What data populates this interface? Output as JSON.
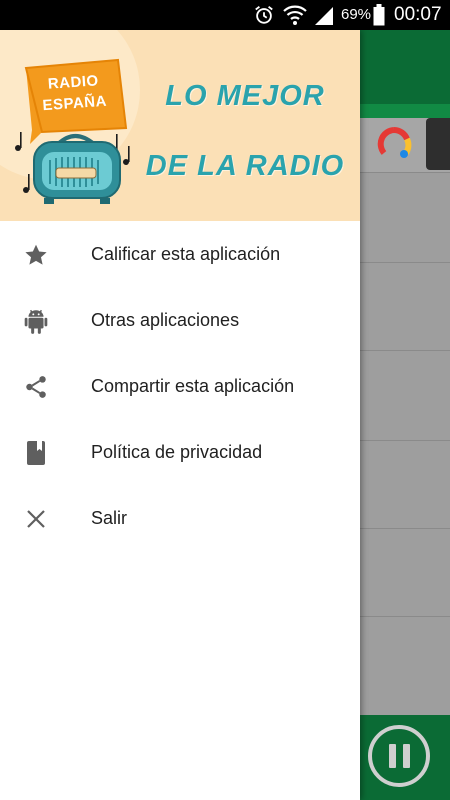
{
  "status_bar": {
    "battery_percent": "69%",
    "time": "00:07",
    "icons": [
      "alarm-icon",
      "wifi-icon",
      "signal-icon",
      "battery-icon"
    ]
  },
  "drawer": {
    "header": {
      "logo_text_line1": "RADIO",
      "logo_text_line2": "ESPAÑA",
      "tagline_line1": "LO MEJOR",
      "tagline_line2": "DE LA RADIO"
    },
    "items": [
      {
        "icon": "star-icon",
        "label": "Calificar esta aplicación"
      },
      {
        "icon": "android-icon",
        "label": "Otras aplicaciones"
      },
      {
        "icon": "share-icon",
        "label": "Compartir esta aplicación"
      },
      {
        "icon": "book-icon",
        "label": "Política de privacidad"
      },
      {
        "icon": "close-icon",
        "label": "Salir"
      }
    ]
  },
  "colors": {
    "toolbar_green": "#0b6b35",
    "header_bg": "#fbe0b6",
    "tagline_teal": "#2aa3ad",
    "logo_orange": "#f39a1d",
    "icon_grey": "#5f5f5f"
  }
}
